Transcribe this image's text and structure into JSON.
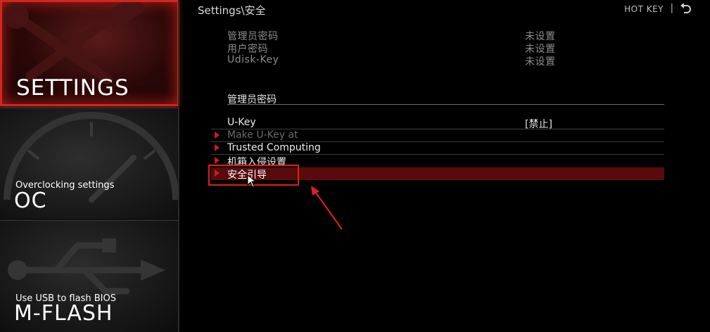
{
  "sidebar": {
    "settings": {
      "title": "SETTINGS",
      "icon": "wrench-hammer-icon",
      "active": true
    },
    "oc": {
      "subtitle": "Overclocking settings",
      "title": "OC",
      "icon": "gauge-icon"
    },
    "mflash": {
      "subtitle": "Use USB to flash BIOS",
      "title": "M-FLASH",
      "icon": "usb-icon"
    }
  },
  "header": {
    "breadcrumb": "Settings\\安全",
    "hotkey_label": "HOT KEY",
    "separator": "|",
    "back_icon": "back-arrow-icon"
  },
  "password_info": [
    {
      "label": "管理员密码",
      "value": "未设置"
    },
    {
      "label": "用户密码",
      "value": "未设置"
    },
    {
      "label": "Udisk-Key",
      "value": "未设置"
    }
  ],
  "section": {
    "title": "管理员密码"
  },
  "items": [
    {
      "label": "U-Key",
      "value": "[禁止]",
      "submenu": false,
      "state": "normal"
    },
    {
      "label": "Make U-Key at",
      "value": "",
      "submenu": true,
      "state": "disabled"
    },
    {
      "label": "Trusted Computing",
      "value": "",
      "submenu": true,
      "state": "normal"
    },
    {
      "label": "机箱入侵设置",
      "value": "",
      "submenu": true,
      "state": "normal"
    },
    {
      "label": "安全引导",
      "value": "",
      "submenu": true,
      "state": "selected"
    }
  ],
  "colors": {
    "accent": "#d2261f",
    "selected_row": "#5a0a0a",
    "annotation": "#e02020"
  }
}
